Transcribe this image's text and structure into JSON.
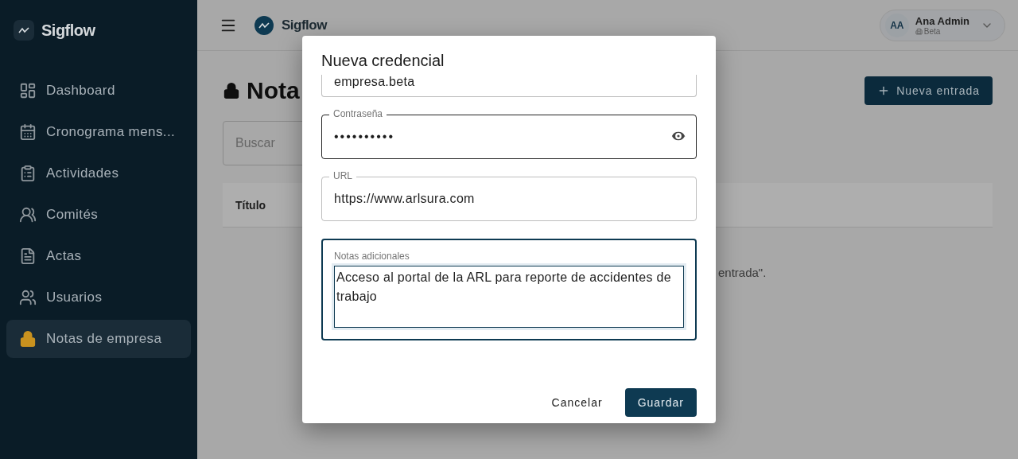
{
  "sidebar": {
    "brand": "Sigflow",
    "items": [
      {
        "label": "Dashboard",
        "selected": false
      },
      {
        "label": "Cronograma mens...",
        "selected": false
      },
      {
        "label": "Actividades",
        "selected": false
      },
      {
        "label": "Comités",
        "selected": false
      },
      {
        "label": "Actas",
        "selected": false
      },
      {
        "label": "Usuarios",
        "selected": false
      },
      {
        "label": "Notas de empresa",
        "selected": true
      }
    ]
  },
  "topbar": {
    "brand": "Sigflow",
    "user": {
      "initials": "AA",
      "name": "Ana Admin",
      "company": "Beta"
    }
  },
  "page": {
    "title": "Nota",
    "new_button": "Nueva entrada",
    "search": {
      "placeholder": "Buscar"
    },
    "table": {
      "columns": [
        "Título"
      ]
    },
    "empty_message": "entrada\"."
  },
  "dialog": {
    "title": "Nueva credencial",
    "fields": [
      {
        "kind": "text",
        "value": "empresa.beta"
      },
      {
        "kind": "password",
        "label": "Contraseña",
        "value": "••••••••••"
      },
      {
        "kind": "text",
        "label": "URL",
        "value": "https://www.arlsura.com"
      },
      {
        "kind": "textarea",
        "label": "Notas adicionales",
        "value": "Acceso al portal de la ARL para reporte de accidentes de trabajo"
      }
    ],
    "buttons": [
      {
        "label": "Cancelar",
        "kind": "text"
      },
      {
        "label": "Guardar",
        "kind": "primary"
      }
    ]
  }
}
